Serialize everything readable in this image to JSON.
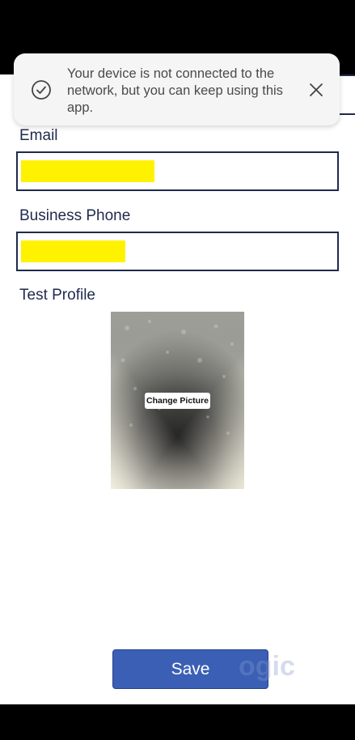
{
  "toast": {
    "message": "Your device is not connected to the network, but you can keep using this app.",
    "icon": "check-circle-icon",
    "close_icon": "close-icon"
  },
  "form": {
    "email_label": "Email",
    "email_value": "",
    "phone_label": "Business Phone",
    "phone_value": "",
    "profile_label": "Test Profile",
    "change_picture_label": "Change Picture"
  },
  "save_label": "Save",
  "watermark_text": "ogic",
  "colors": {
    "accent": "#3a5fb5",
    "label": "#1f2a4d",
    "redaction": "#fff200"
  }
}
